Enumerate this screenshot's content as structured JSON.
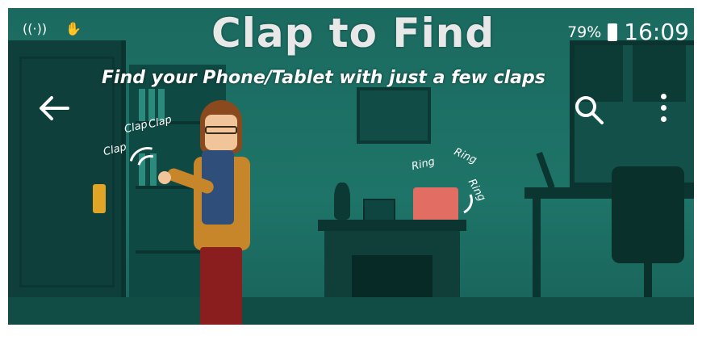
{
  "status_bar": {
    "signal_icon": "wifi-hotspot-icon",
    "hand_icon": "hand-icon",
    "battery_percent": "79%",
    "time": "16:09"
  },
  "header": {
    "title": "Clap to Find",
    "subtitle": "Find your Phone/Tablet with just a few claps"
  },
  "toolbar": {
    "back_icon": "arrow-left-icon",
    "search_icon": "search-icon",
    "more_icon": "more-vertical-icon"
  },
  "illustration": {
    "clap_words": [
      "Clap",
      "Clap",
      "Clap"
    ],
    "ring_words": [
      "Ring",
      "Ring",
      "Ring"
    ]
  },
  "colors": {
    "background": "#1d6e63",
    "accent": "#e26d63"
  }
}
